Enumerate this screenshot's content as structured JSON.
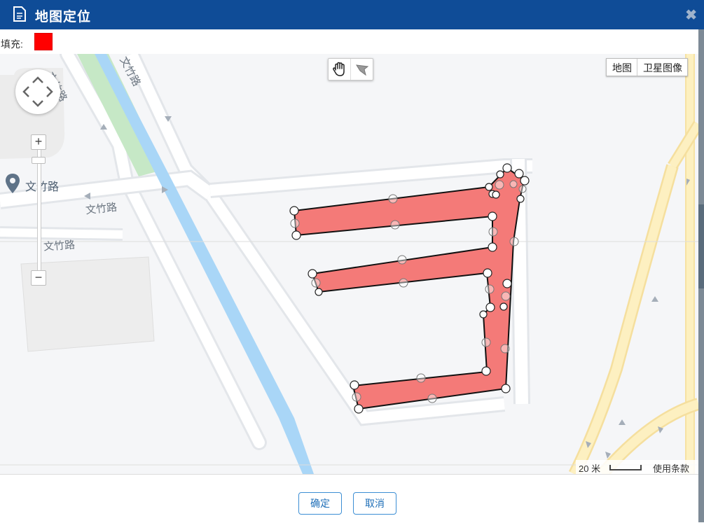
{
  "dialog": {
    "title": "地图定位",
    "close_glyph": "✖"
  },
  "fill": {
    "label": "填充:",
    "color": "#ff0000"
  },
  "map": {
    "map_type_options": [
      "地图",
      "卫星图像"
    ],
    "road_labels": [
      "文竹路",
      "文竹路",
      "文竹路",
      "文竹路"
    ],
    "poi_label": "文竹路",
    "scale_text": "20 米",
    "terms_text": "使用条款",
    "polygon_fill": "#f47a78",
    "polygon_stroke": "#111111"
  },
  "footer": {
    "ok_label": "确定",
    "cancel_label": "取消"
  }
}
